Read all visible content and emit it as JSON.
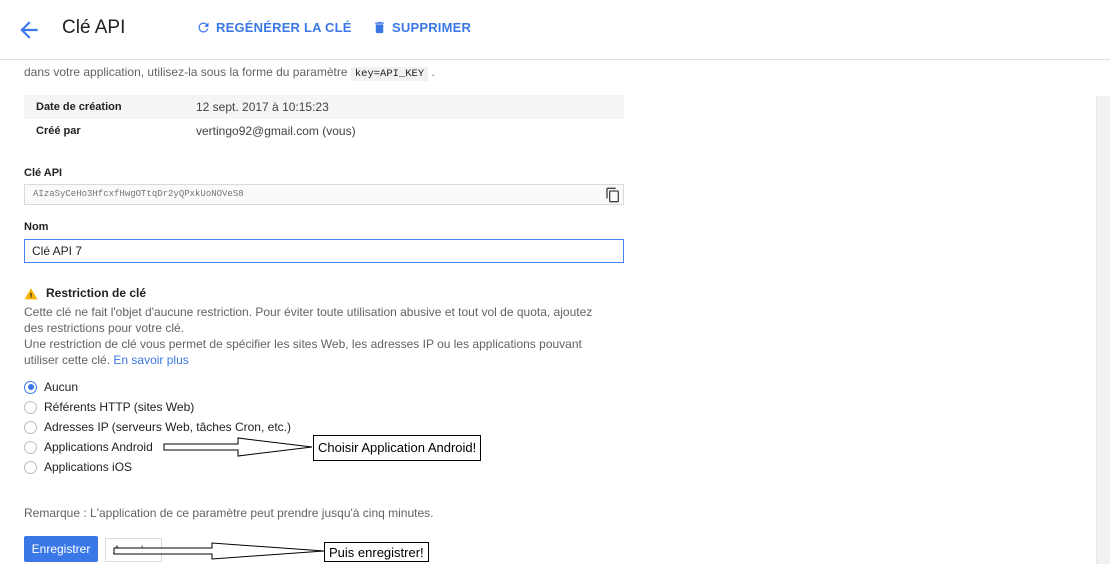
{
  "header": {
    "title": "Clé API",
    "regen_label": "REGÉNÉRER LA CLÉ",
    "delete_label": "SUPPRIMER"
  },
  "intro": {
    "text": "dans votre application, utilisez-la sous la forme du paramètre",
    "param": "key=API_KEY",
    "suffix": "."
  },
  "info": {
    "created_label": "Date de création",
    "created_value": "12 sept. 2017 à 10:15:23",
    "by_label": "Créé par",
    "by_value": "vertingo92@gmail.com (vous)"
  },
  "api_key": {
    "label": "Clé API",
    "value": "AIzaSyCeHo3HfcxfHwgOTtqDr2yQPxkUoNOVeS8"
  },
  "name_field": {
    "label": "Nom",
    "value": "Clé API 7"
  },
  "restriction": {
    "title": "Restriction de clé",
    "line1": "Cette clé ne fait l'objet d'aucune restriction. Pour éviter toute utilisation abusive et tout vol de quota, ajoutez",
    "line2": "des restrictions pour votre clé.",
    "line3": "Une restriction de clé vous permet de spécifier les sites Web, les adresses IP ou les applications pouvant",
    "line4": "utiliser cette clé.",
    "learn_more": "En savoir plus",
    "options": [
      {
        "label": "Aucun",
        "checked": true
      },
      {
        "label": "Référents HTTP (sites Web)",
        "checked": false
      },
      {
        "label": "Adresses IP (serveurs Web, tâches Cron, etc.)",
        "checked": false
      },
      {
        "label": "Applications Android",
        "checked": false
      },
      {
        "label": "Applications iOS",
        "checked": false
      }
    ]
  },
  "note": "Remarque : L'application de ce paramètre peut prendre jusqu'à cinq minutes.",
  "actions": {
    "save": "Enregistrer",
    "cancel": "Annuler"
  },
  "annotations": {
    "android": "Choisir Application Android!",
    "save": "Puis enregistrer!"
  },
  "colors": {
    "accent": "#3b78e7",
    "warning": "#f4b400"
  }
}
